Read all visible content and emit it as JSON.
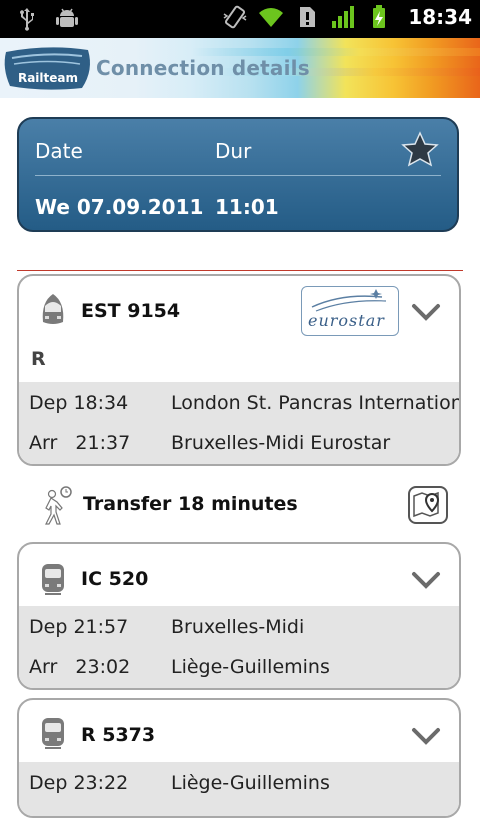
{
  "status_bar": {
    "time": "18:34"
  },
  "header": {
    "logo_text": "Railteam",
    "title": "Connection details"
  },
  "summary": {
    "date_label": "Date",
    "duration_label": "Dur",
    "date_value": "We 07.09.2011",
    "duration_value": "11:01"
  },
  "legs": [
    {
      "train": "EST 9154",
      "operator_logo_text": "eurostar",
      "tag": "R",
      "dep_label": "Dep",
      "dep_time": "18:34",
      "dep_station": "London St. Pancras International",
      "arr_label": "Arr",
      "arr_time": "21:37",
      "arr_station": "Bruxelles-Midi Eurostar"
    },
    {
      "train": "IC 520",
      "dep_label": "Dep",
      "dep_time": "21:57",
      "dep_station": "Bruxelles-Midi",
      "arr_label": "Arr",
      "arr_time": "23:02",
      "arr_station": "Liège-Guillemins"
    },
    {
      "train": "R 5373",
      "dep_label": "Dep",
      "dep_time": "23:22",
      "dep_station": "Liège-Guillemins"
    }
  ],
  "transfer": {
    "text": "Transfer 18 minutes"
  },
  "colors": {
    "panel": "#2f6a95",
    "accent_line": "#c0392b",
    "row_bg": "#e4e4e4"
  }
}
